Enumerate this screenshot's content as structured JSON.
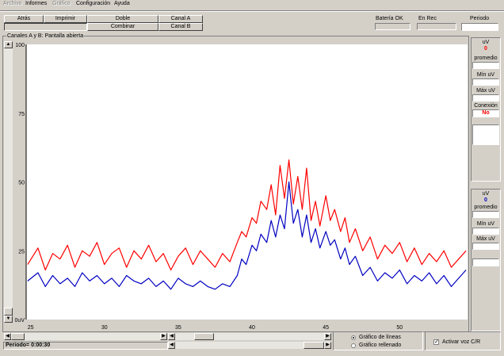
{
  "menu": {
    "items": [
      {
        "label": "Archivo",
        "disabled": true
      },
      {
        "label": "Informes",
        "disabled": false
      },
      {
        "label": "Gráfico",
        "disabled": true
      },
      {
        "label": "Configuración",
        "disabled": false
      },
      {
        "label": "Ayuda",
        "disabled": false
      }
    ]
  },
  "toolbar": {
    "back_label": "Atrás",
    "print_label": "Imprimir",
    "double_label": "Doble",
    "combine_label": "Combinar",
    "channel_a_label": "Canal A",
    "channel_b_label": "Canal B",
    "battery_label": "Batería OK",
    "rec_label": "En Rec",
    "period_label": "Periodo",
    "period_value": ""
  },
  "chart_panel": {
    "title": "Canales A y B: Pantalla abierta",
    "title_color": "#ff0000"
  },
  "side_top": {
    "uv_label": "uV",
    "uv_value": "0",
    "avg_label": "promedio",
    "min_label": "Mín uV",
    "max_label": "Máx uV",
    "conn_label": "Conexión",
    "conn_value": "No",
    "value_color": "#ff0000"
  },
  "side_bottom": {
    "uv_label": "uV",
    "uv_value": "0",
    "avg_label": "promedio",
    "min_label": "Mín uV",
    "max_label": "Máx uV",
    "value_color": "#0000c0"
  },
  "bottom": {
    "period_text": "Periodo= 0:00:30",
    "line_chart_label": "Gráfico de líneas",
    "filled_chart_label": "Gráfico rellenado",
    "voice_label": "Activar voz C/R",
    "line_chart_selected": true,
    "voice_checked": true
  },
  "chart_data": {
    "type": "line",
    "ylim": [
      0,
      100
    ],
    "xlim": [
      24.7,
      54.6
    ],
    "y_ticks": [
      "100",
      "75",
      "50",
      "25",
      "0uV"
    ],
    "y_tick_values": [
      100,
      75,
      50,
      25,
      0
    ],
    "x_ticks": [
      "25",
      "30",
      "35",
      "40",
      "45",
      "50"
    ],
    "x_tick_values": [
      25,
      30,
      35,
      40,
      45,
      50
    ],
    "series": [
      {
        "color": "#ff0000",
        "x": [
          24.8,
          25.5,
          26.0,
          26.5,
          27.0,
          27.5,
          28.0,
          28.5,
          29.0,
          29.5,
          30.0,
          30.5,
          31.0,
          31.5,
          32.0,
          32.5,
          33.0,
          33.5,
          34.0,
          34.5,
          35.0,
          35.5,
          36.0,
          36.5,
          37.0,
          37.5,
          38.0,
          38.5,
          39.0,
          39.3,
          39.6,
          40.0,
          40.3,
          40.6,
          41.0,
          41.3,
          41.6,
          41.9,
          42.2,
          42.5,
          42.8,
          43.1,
          43.4,
          43.7,
          44.0,
          44.3,
          44.6,
          45.0,
          45.3,
          45.6,
          46.0,
          46.3,
          46.6,
          47.0,
          47.5,
          48.0,
          48.5,
          49.0,
          49.5,
          50.0,
          50.5,
          51.0,
          51.5,
          52.0,
          52.5,
          53.0,
          53.5,
          54.0,
          54.5
        ],
        "y": [
          20,
          26,
          18,
          24,
          22,
          27,
          19,
          25,
          23,
          28,
          20,
          24,
          26,
          19,
          25,
          22,
          27,
          21,
          24,
          18,
          23,
          26,
          20,
          25,
          22,
          19,
          24,
          21,
          28,
          32,
          30,
          37,
          35,
          43,
          40,
          49,
          38,
          56,
          44,
          58,
          42,
          52,
          40,
          55,
          36,
          43,
          34,
          45,
          36,
          40,
          32,
          37,
          28,
          33,
          25,
          30,
          22,
          27,
          24,
          28,
          21,
          26,
          20,
          24,
          21,
          25,
          19,
          22,
          25
        ]
      },
      {
        "color": "#0000c0",
        "x": [
          24.8,
          25.5,
          26.0,
          26.5,
          27.0,
          27.5,
          28.0,
          28.5,
          29.0,
          29.5,
          30.0,
          30.5,
          31.0,
          31.5,
          32.0,
          32.5,
          33.0,
          33.5,
          34.0,
          34.5,
          35.0,
          35.5,
          36.0,
          36.5,
          37.0,
          37.5,
          38.0,
          38.5,
          39.0,
          39.3,
          39.6,
          40.0,
          40.3,
          40.6,
          41.0,
          41.3,
          41.6,
          41.9,
          42.2,
          42.5,
          42.8,
          43.1,
          43.4,
          43.7,
          44.0,
          44.3,
          44.6,
          45.0,
          45.3,
          45.6,
          46.0,
          46.3,
          46.6,
          47.0,
          47.5,
          48.0,
          48.5,
          49.0,
          49.5,
          50.0,
          50.5,
          51.0,
          51.5,
          52.0,
          52.5,
          53.0,
          53.5,
          54.0,
          54.5
        ],
        "y": [
          14,
          17,
          12,
          16,
          13,
          15,
          12,
          17,
          14,
          16,
          13,
          15,
          12,
          16,
          14,
          13,
          15,
          12,
          14,
          11,
          15,
          13,
          12,
          14,
          12,
          11,
          13,
          12,
          16,
          22,
          20,
          27,
          25,
          31,
          28,
          36,
          30,
          38,
          33,
          50,
          35,
          40,
          30,
          38,
          28,
          33,
          26,
          32,
          27,
          29,
          22,
          26,
          20,
          23,
          16,
          19,
          14,
          17,
          15,
          18,
          13,
          16,
          14,
          17,
          13,
          16,
          12,
          15,
          18
        ]
      }
    ]
  }
}
